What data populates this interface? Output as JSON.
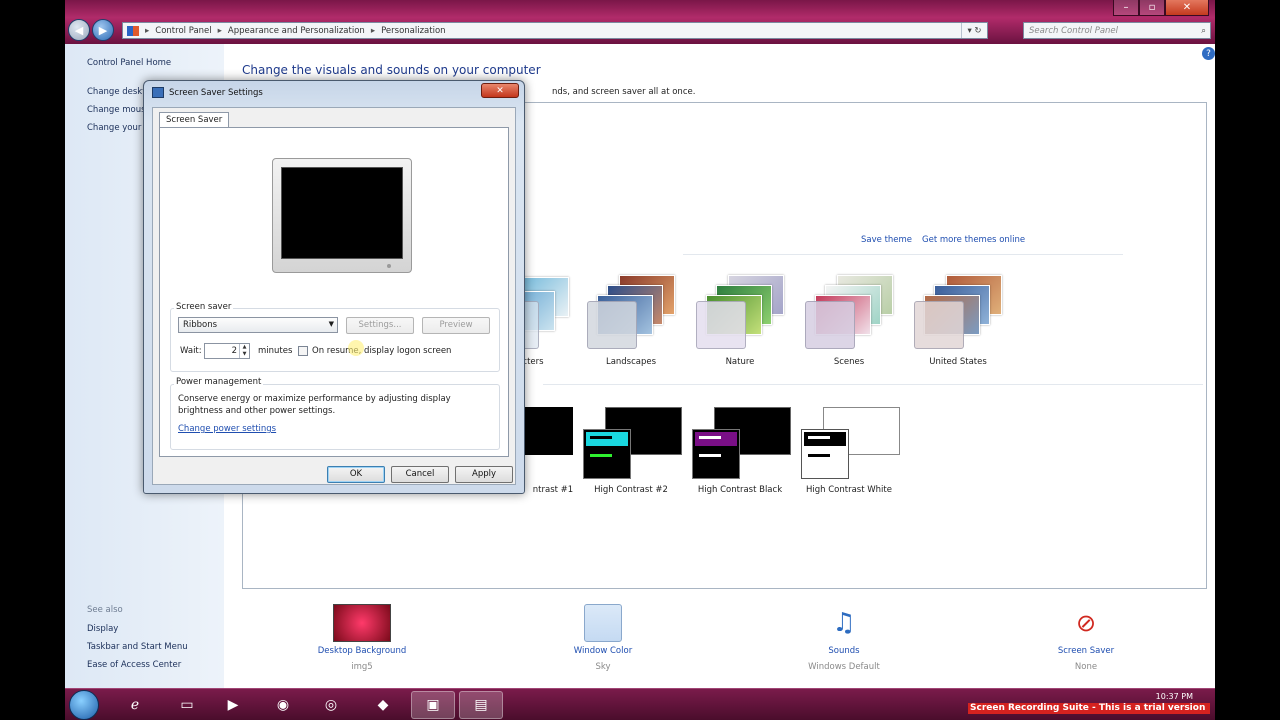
{
  "address_bar": {
    "crumbs": [
      "Control Panel",
      "Appearance and Personalization",
      "Personalization"
    ]
  },
  "search": {
    "placeholder": "Search Control Panel"
  },
  "sidebar": {
    "items": [
      {
        "label": "Control Panel Home"
      },
      {
        "label": "Change desktop icons"
      },
      {
        "label": "Change mouse pointers"
      },
      {
        "label": "Change your account picture"
      }
    ],
    "see_also_label": "See also",
    "see_also": [
      {
        "label": "Display"
      },
      {
        "label": "Taskbar and Start Menu"
      },
      {
        "label": "Ease of Access Center"
      }
    ]
  },
  "main": {
    "title": "Change the visuals and sounds on your computer",
    "subtitle": "nds, and screen saver all at once.",
    "save_theme": "Save theme",
    "more_themes": "Get more themes online",
    "themes": [
      {
        "label": "cters"
      },
      {
        "label": "Landscapes"
      },
      {
        "label": "Nature"
      },
      {
        "label": "Scenes"
      },
      {
        "label": "United States"
      }
    ],
    "hc_themes": [
      {
        "label": "ntrast #1"
      },
      {
        "label": "High Contrast #2"
      },
      {
        "label": "High Contrast Black"
      },
      {
        "label": "High Contrast White"
      }
    ],
    "bottom": [
      {
        "label": "Desktop Background",
        "sub": "img5"
      },
      {
        "label": "Window Color",
        "sub": "Sky"
      },
      {
        "label": "Sounds",
        "sub": "Windows Default"
      },
      {
        "label": "Screen Saver",
        "sub": "None"
      }
    ]
  },
  "dialog": {
    "title": "Screen Saver Settings",
    "tab": "Screen Saver",
    "screensaver_group": "Screen saver",
    "screensaver_value": "Ribbons",
    "settings_btn": "Settings...",
    "preview_btn": "Preview",
    "wait_label": "Wait:",
    "wait_value": "2",
    "minutes_label": "minutes",
    "resume_label": "On resume, display logon screen",
    "power_group": "Power management",
    "power_text_1": "Conserve energy or maximize performance by adjusting display",
    "power_text_2": "brightness and other power settings.",
    "power_link": "Change power settings",
    "ok": "OK",
    "cancel": "Cancel",
    "apply": "Apply"
  },
  "taskbar": {
    "time": "10:37 PM"
  },
  "watermark": "Screen Recording Suite - This is a trial version",
  "colors": {
    "accent": "#1f4eb0",
    "title": "#1e3a8c",
    "titlebar": "#b12b6a"
  }
}
